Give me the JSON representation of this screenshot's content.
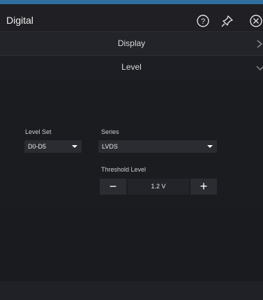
{
  "window": {
    "title": "Digital"
  },
  "header_icons": {
    "help": "help-circle-icon",
    "pin": "pin-icon",
    "close": "close-circle-icon"
  },
  "sections": {
    "display_label": "Display",
    "level_label": "Level"
  },
  "level_set": {
    "label": "Level Set",
    "value": "D0-D5"
  },
  "series": {
    "label": "Series",
    "value": "LVDS"
  },
  "threshold": {
    "label": "Threshold Level",
    "value": "1.2 V",
    "minus": "−",
    "plus": "+"
  },
  "colors": {
    "accent": "#2e6f9d",
    "background": "#1c1d21",
    "control": "#2b2c31"
  }
}
